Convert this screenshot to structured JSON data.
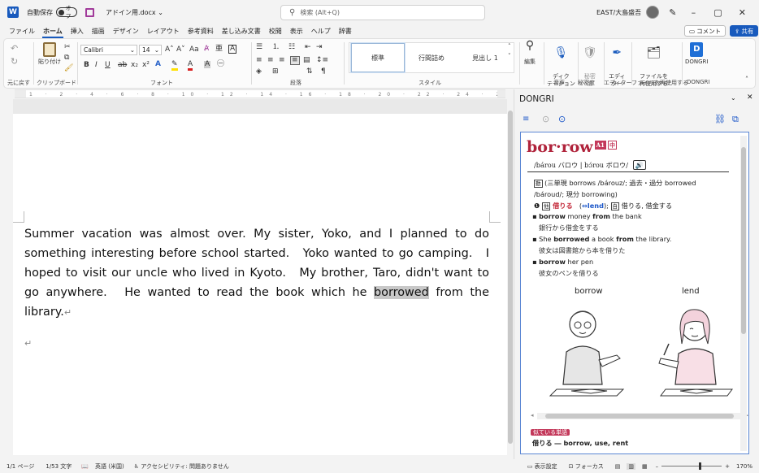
{
  "titlebar": {
    "autosave_label": "自動保存",
    "autosave_state": "オフ",
    "filename": "アドイン用.docx",
    "search_placeholder": "検索 (Alt+Q)",
    "user": "EAST/大島盛吾"
  },
  "menu": {
    "tabs": [
      "ファイル",
      "ホーム",
      "挿入",
      "描画",
      "デザイン",
      "レイアウト",
      "参考資料",
      "差し込み文書",
      "校閲",
      "表示",
      "ヘルプ",
      "辞書"
    ],
    "active": "ホーム",
    "comment_label": "コメント",
    "share_label": "共有"
  },
  "ribbon": {
    "undo_group": "元に戻す",
    "clipboard_group": "クリップボード",
    "paste_label": "貼り付け",
    "font_group": "フォント",
    "font_name": "Calibri",
    "font_size": "14",
    "paragraph_group": "段落",
    "style_group": "スタイル",
    "styles": [
      "標準",
      "行間詰め",
      "見出し 1"
    ],
    "edit_label": "編集",
    "dictate_label": "ディク\nテーション",
    "sensitivity_label": "秘密\n度",
    "editor_label": "エディ\nター",
    "reuse_label": "ファイルを\n再使用する",
    "dongri_label": "DONGRI",
    "voice_group": "音声",
    "sensitivity_group": "秘密度",
    "editor_group": "エディター",
    "reuse_group": "ファイルを再使用する",
    "dongri_group": "DONGRI"
  },
  "document": {
    "text_before": "Summer vacation was almost over. My sister, Yoko, and I planned to do something interesting before school started.　Yoko wanted to go camping.　I hoped to visit our uncle who lived in Kyoto.　My brother, Taro, didn't want to go anywhere.　He wanted to read the book which he ",
    "highlighted": "borrowed",
    "text_after": " from the library."
  },
  "pane": {
    "title": "DONGRI",
    "headword": "bor·row",
    "tags": [
      "A1",
      "中"
    ],
    "pronunciation": "/bárou バロウ | bɔ́rou ボロウ/",
    "inflection_1": "(三単現 borrows /bárouz/; 過去・過分 borrowed",
    "inflection_2": "/bároud/; 現分 borrowing)",
    "sense_label": "借りる",
    "sense_antonym": "⇔lend",
    "sense_translation": "借りる, 借金する",
    "examples": [
      {
        "en_pre": "",
        "en_bold": "borrow",
        "en_mid": " money ",
        "en_bold2": "from",
        "en_post": " the bank",
        "ja": "銀行から借金をする"
      },
      {
        "en_pre": "She ",
        "en_bold": "borrowed",
        "en_mid": " a book ",
        "en_bold2": "from",
        "en_post": " the library.",
        "ja": "彼女は図書館から本を借りた"
      },
      {
        "en_pre": "",
        "en_bold": "borrow",
        "en_mid": " her pen",
        "en_bold2": "",
        "en_post": "",
        "ja": "彼女のペンを借りる"
      }
    ],
    "illus_left": "borrow",
    "illus_right": "lend",
    "bottom_tag": "似ている単語",
    "bottom_text": "借りる ― borrow, use, rent"
  },
  "status": {
    "page": "1/1 ページ",
    "words": "1/53 文字",
    "language": "英語 (米国)",
    "accessibility": "アクセシビリティ: 問題ありません",
    "display_settings": "表示設定",
    "focus": "フォーカス",
    "zoom": "170%"
  }
}
